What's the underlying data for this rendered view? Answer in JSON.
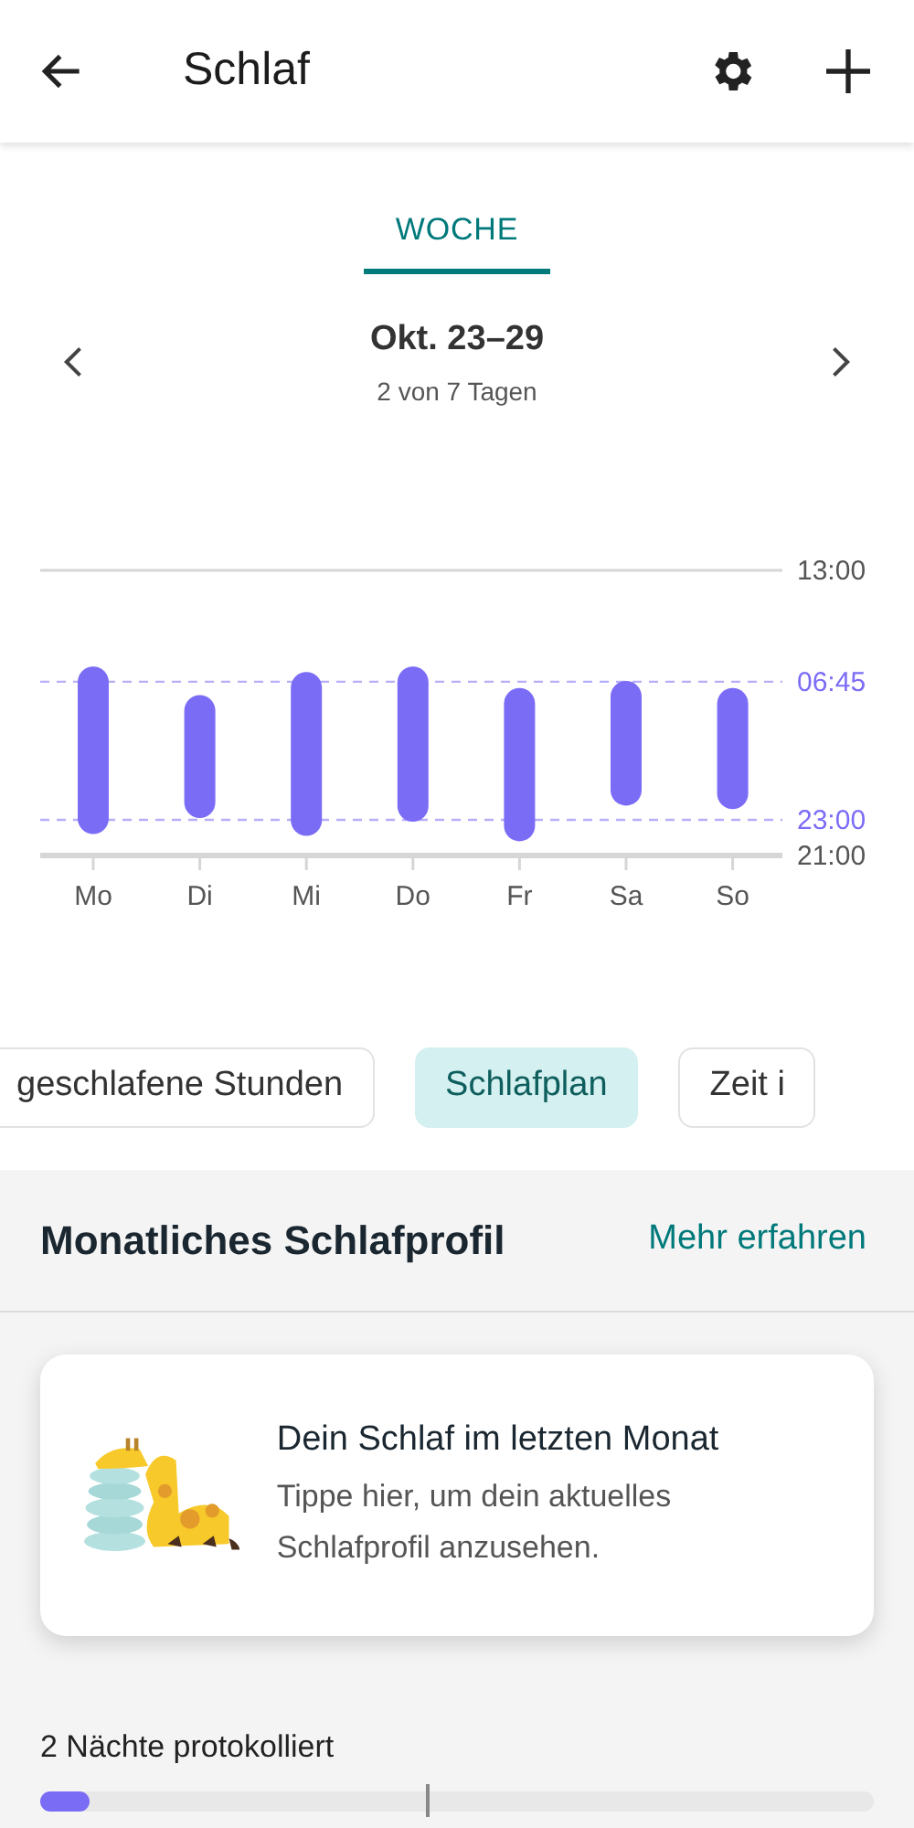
{
  "header": {
    "title": "Schlaf"
  },
  "tabs": [
    {
      "label": "WOCHE",
      "selected": true
    }
  ],
  "period": {
    "title": "Okt. 23–29",
    "subtitle": "2 von 7 Tagen"
  },
  "sleep_chart": {
    "axis_labels": [
      {
        "label": "13:00",
        "kind": "grid"
      },
      {
        "label": "06:45",
        "kind": "target"
      },
      {
        "label": "23:00",
        "kind": "target"
      },
      {
        "label": "21:00",
        "kind": "axis"
      }
    ],
    "days": [
      "Mo",
      "Di",
      "Mi",
      "Do",
      "Fr",
      "Sa",
      "So"
    ]
  },
  "chips": [
    {
      "label": "geschlafene Stunden",
      "selected": false
    },
    {
      "label": "Schlafplan",
      "selected": true
    },
    {
      "label": "Zeit i",
      "selected": false
    }
  ],
  "profile": {
    "title": "Monatliches Schlafprofil",
    "link": "Mehr erfahren",
    "card": {
      "title": "Dein Schlaf im letzten Monat",
      "text": "Tippe hier, um dein aktuelles Schlafprofil anzusehen."
    },
    "progress": {
      "label": "2 Nächte protokolliert",
      "level": 0.06
    }
  }
}
